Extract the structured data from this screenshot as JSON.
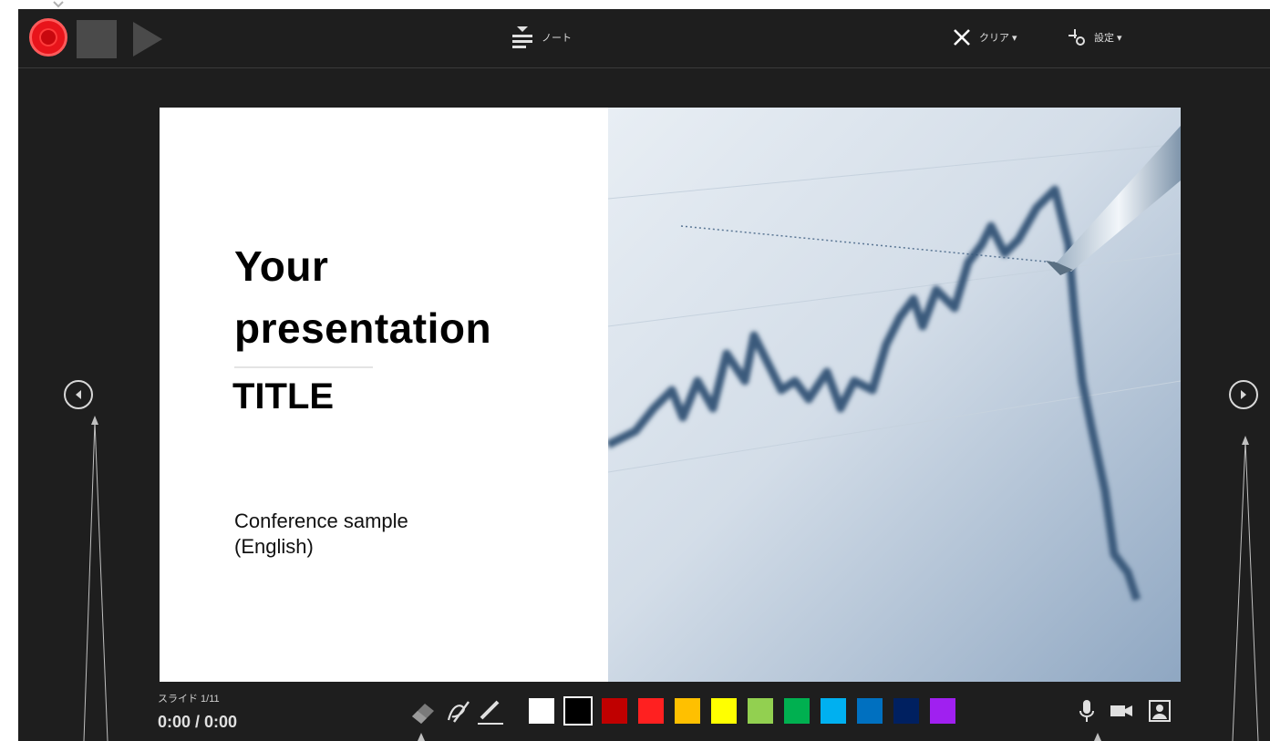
{
  "toolbar": {
    "notes_label": "ノート",
    "clear_label": "クリア ▾",
    "settings_label": "設定 ▾",
    "icons": [
      "record-icon",
      "stop-icon",
      "play-icon",
      "notes-icon",
      "close-x-icon",
      "settings-icon"
    ]
  },
  "slide": {
    "title_line_1": "Your",
    "title_line_2": "presentation",
    "title_line_3": "TITLE",
    "subtitle_line_1": "Conference sample",
    "subtitle_line_2": "(English)",
    "image": "line-chart-photo-with-pen"
  },
  "footer": {
    "slide_counter": "スライド 1/11",
    "timer": "0:00 / 0:00",
    "pen_tools": [
      "eraser-icon",
      "pen-icon",
      "highlighter-icon"
    ],
    "media_icons": [
      "microphone-icon",
      "camera-icon",
      "camera-preview-icon"
    ]
  },
  "colors": {
    "background": "#1e1e1e",
    "record": "#e8141b",
    "ink_swatches": [
      "#ffffff",
      "#000000",
      "#c00000",
      "#ff2020",
      "#ffc000",
      "#ffff00",
      "#92d050",
      "#00b050",
      "#00b0f0",
      "#0070c0",
      "#002060",
      "#a020f0"
    ]
  }
}
